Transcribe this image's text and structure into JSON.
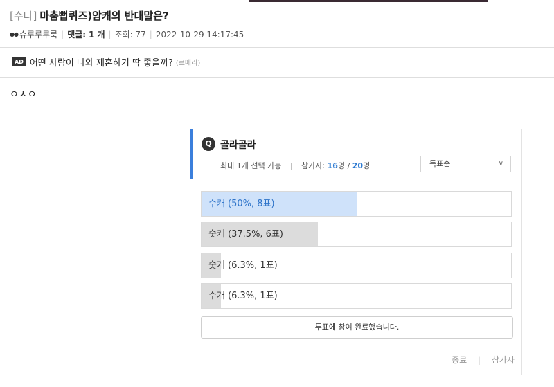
{
  "post": {
    "category": "[수다]",
    "title": "마춤뻡퀴즈)암캐의 반대말은?",
    "author": "슈루루루룩",
    "comments_label": "댓글:",
    "comments_count": "1 개",
    "views_label": "조회:",
    "views_count": "77",
    "datetime": "2022-10-29 14:17:45",
    "body": "ㅇㅅㅇ"
  },
  "ad": {
    "badge": "AD",
    "text": "어떤 사람이 나와 재혼하기 딱 좋을까?",
    "source": "(르메리)"
  },
  "poll": {
    "icon": "Q",
    "title": "골라골라",
    "max_select": "최대 1개 선택 가능",
    "participants_label": "참가자:",
    "participants": "16",
    "participants_unit": "명",
    "slash": "/",
    "total": "20",
    "total_unit": "명",
    "sort_selected": "득표순",
    "options": [
      {
        "label": "수캐 (50%, 8표)",
        "percent": 50
      },
      {
        "label": "숫캐 (37.5%, 6표)",
        "percent": 37.5
      },
      {
        "label": "숫개 (6.3%, 1표)",
        "percent": 6.3
      },
      {
        "label": "수개 (6.3%, 1표)",
        "percent": 6.3
      }
    ],
    "done_label": "투표에 참여 완료했습니다.",
    "end_label": "종료",
    "participants_link": "참가자"
  },
  "colors": {
    "accent": "#3b7fdc",
    "top_choice_fill": "#cfe2fa",
    "other_fill": "#dcdcdc"
  }
}
